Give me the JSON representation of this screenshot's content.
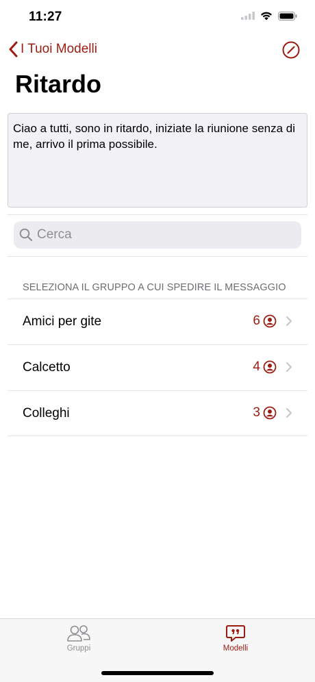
{
  "status_bar": {
    "time": "11:27"
  },
  "nav": {
    "back_label": "I Tuoi Modelli",
    "back_icon": "chevron-left-icon",
    "edit_icon": "pencil-circle-icon"
  },
  "page": {
    "title": "Ritardo"
  },
  "message": {
    "text": "Ciao a tutti, sono in ritardo, iniziate la riunione senza di me, arrivo il prima possibile."
  },
  "search": {
    "placeholder": "Cerca"
  },
  "section": {
    "header": "SELEZIONA IL GRUPPO A CUI SPEDIRE IL MESSAGGIO"
  },
  "groups": [
    {
      "name": "Amici per gite",
      "count": "6"
    },
    {
      "name": "Calcetto",
      "count": "4"
    },
    {
      "name": "Colleghi",
      "count": "3"
    }
  ],
  "tabs": [
    {
      "label": "Gruppi",
      "icon": "people-icon",
      "selected": false
    },
    {
      "label": "Modelli",
      "icon": "quote-bubble-icon",
      "selected": true
    }
  ],
  "colors": {
    "accent": "#9b1c12",
    "inactive": "#8e8e93",
    "field_bg": "#f2f2f6"
  }
}
